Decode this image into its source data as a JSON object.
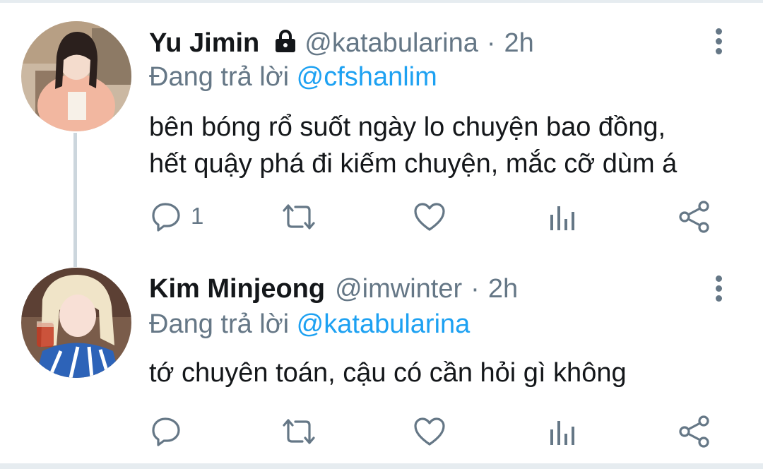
{
  "colors": {
    "text": "#14171a",
    "muted": "#657786",
    "link": "#1da1f2",
    "divider": "#e6ecf0"
  },
  "tweets": [
    {
      "display_name": "Yu Jimin",
      "protected_icon": "lock-icon",
      "handle": "@katabularina",
      "separator": "·",
      "time": "2h",
      "reply_prefix": "Đang trả lời",
      "reply_to": "@cfshanlim",
      "text_lines": [
        "bên bóng rổ suốt ngày lo chuyện bao đồng,",
        "hết quậy phá đi kiếm chuyện, mắc cỡ dùm á"
      ],
      "reply_count": "1"
    },
    {
      "display_name": "Kim Minjeong",
      "handle": "@imwinter",
      "separator": "·",
      "time": "2h",
      "reply_prefix": "Đang trả lời",
      "reply_to": "@katabularina",
      "text_lines": [
        "tớ chuyên toán, cậu có cần hỏi gì không"
      ],
      "reply_count": ""
    }
  ],
  "action_icons": [
    "reply-icon",
    "retweet-icon",
    "like-icon",
    "analytics-icon",
    "share-icon"
  ]
}
